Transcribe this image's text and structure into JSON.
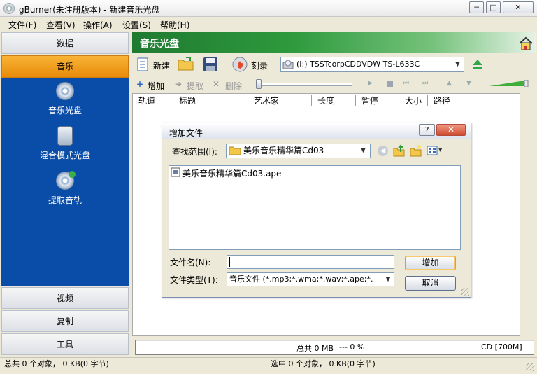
{
  "window": {
    "title": "gBurner(未注册版本) - 新建音乐光盘",
    "controls": {
      "minimize": "─",
      "maximize": "□",
      "close": "✕"
    }
  },
  "menu": [
    "文件(F)",
    "查看(V)",
    "操作(A)",
    "设置(S)",
    "帮助(H)"
  ],
  "sidebar": {
    "top": "数据",
    "active": "音乐",
    "sub_items": [
      "音乐光盘",
      "混合模式光盘",
      "提取音轨"
    ],
    "bottom": [
      "视频",
      "复制",
      "工具"
    ]
  },
  "main": {
    "title": "音乐光盘",
    "toolbar": {
      "new_label": "新建",
      "burn_label": "刻录",
      "drive": "(I:) TSSTcorpCDDVDW TS-L633C"
    },
    "toolbar2": {
      "add": "增加",
      "extract": "提取",
      "delete": "删除"
    },
    "columns": [
      "轨道",
      "标题",
      "艺术家",
      "长度",
      "暂停",
      "大小",
      "路径"
    ],
    "status_total": "总共 0 MB",
    "status_percent": "--- 0 %",
    "status_disc": "CD [700M]"
  },
  "statusbar": {
    "left": "总共 0 个对象， 0 KB(0 字节)",
    "right": "选中 0 个对象， 0 KB(0 字节)"
  },
  "dialog": {
    "title": "增加文件",
    "help": "?",
    "close": "✕",
    "look_in_label": "查找范围(I):",
    "look_in_value": "美乐音乐精华篇Cd03",
    "files": [
      "美乐音乐精华篇Cd03.ape"
    ],
    "filename_label": "文件名(N):",
    "filename_value": "",
    "filetype_label": "文件类型(T):",
    "filetype_value": "音乐文件 (*.mp3;*.wma;*.wav;*.ape;*.",
    "add_button": "增加",
    "cancel_button": "取消"
  },
  "colors": {
    "sidebar_blue": "#0a4da8",
    "active_orange": "#f0a020",
    "header_green": "#2e9a3d"
  }
}
